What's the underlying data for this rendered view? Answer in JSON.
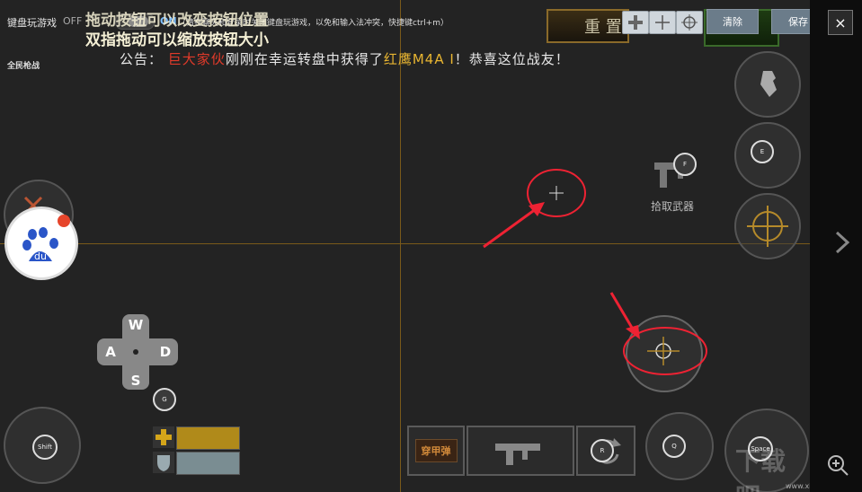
{
  "topbar": {
    "title": "键盘玩游戏",
    "off_label": "OFF",
    "on_label": "ON",
    "hint": "（请在聊天和登录时关闭键盘玩游戏，以免和输入法冲突，快捷键ctrl+m）",
    "clear_label": "清除",
    "save_label": "保存",
    "close_label": "×"
  },
  "game": {
    "mode": "全民枪战",
    "hint_line1": "拖动按钮可以改变按钮位置",
    "hint_line2": "双指拖动可以缩放按钮大小",
    "notice_prefix": "公告：",
    "notice_player": "巨大家伙",
    "notice_middle": "刚刚在幸运转盘中获得了",
    "notice_item": "红鹰M4A I",
    "notice_suffix": "！恭喜这位战友！",
    "reset_label": "重 置",
    "pickup_label": "拾取武器",
    "armor_ammo_label": "穿甲弹",
    "baidu_label": "du"
  },
  "keys": {
    "w": "W",
    "a": "A",
    "s": "S",
    "d": "D",
    "g": "G",
    "f": "F",
    "e": "E",
    "r": "R",
    "q": "Q",
    "shift": "Shift",
    "space": "Space"
  },
  "watermark": "下载吧",
  "watermark_small": "www.xiazaiba.com",
  "colors": {
    "accent_red": "#e03a2a",
    "accent_gold": "#e8b531",
    "crosshair_line": "#7a5a1a"
  }
}
